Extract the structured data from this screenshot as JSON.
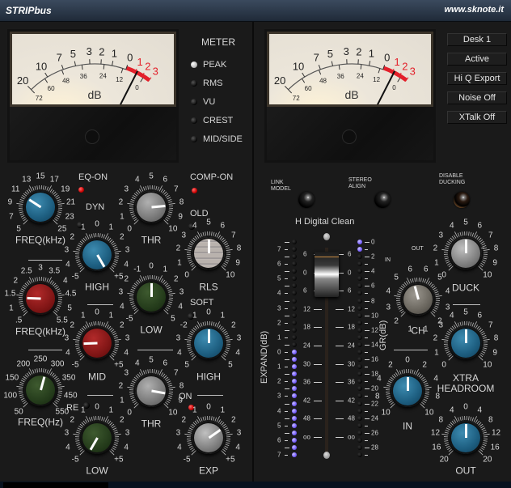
{
  "window": {
    "title": "STRIPbus",
    "url": "www.sknote.it"
  },
  "meter_left": {
    "upper_scale": [
      "20",
      "10",
      "7",
      "5",
      "3",
      "2",
      "1",
      "0",
      "1",
      "2",
      "3"
    ],
    "lower_scale": [
      "72",
      "60",
      "48",
      "36",
      "24",
      "12",
      "0"
    ],
    "unit": "dB",
    "needle_level_db": 1.2
  },
  "meter_right": {
    "upper_scale": [
      "20",
      "10",
      "7",
      "5",
      "3",
      "2",
      "1",
      "0",
      "1",
      "2",
      "3"
    ],
    "lower_scale": [
      "72",
      "60",
      "48",
      "36",
      "24",
      "12",
      "0"
    ],
    "unit": "dB",
    "needle_level_db": 1.2
  },
  "meter_modes": {
    "title": "METER",
    "options": [
      {
        "label": "PEAK",
        "selected": true
      },
      {
        "label": "RMS",
        "selected": false
      },
      {
        "label": "VU",
        "selected": false
      },
      {
        "label": "CREST",
        "selected": false
      },
      {
        "label": "MID/SIDE",
        "selected": false
      }
    ]
  },
  "buttons": [
    "Desk 1",
    "Active",
    "Hi Q Export",
    "Noise Off",
    "XTalk Off"
  ],
  "eq": {
    "on_label": "EQ-ON",
    "dyn_label": "DYN",
    "re_label": "RE",
    "high_freq": {
      "label": "FREQ(kHz)",
      "scale": [
        "5",
        "7",
        "9",
        "11",
        "13",
        "15",
        "17",
        "19",
        "21",
        "23",
        "25"
      ],
      "value": "11"
    },
    "high_gain": {
      "label": "HIGH",
      "scale": [
        "-5",
        "4",
        "3",
        "2",
        "1",
        "0",
        "1",
        "2",
        "3",
        "4",
        "+5"
      ],
      "value": "+3.5"
    },
    "mid_freq": {
      "label": "FREQ(kHz)",
      "scale": [
        ".5",
        "1",
        "1.5",
        "2",
        "2.5",
        "3",
        "3.5",
        "4",
        "4.5",
        "5",
        "5.5"
      ],
      "value": "1.5"
    },
    "mid_gain": {
      "label": "MID",
      "scale": [
        "-5",
        "4",
        "3",
        "2",
        "1",
        "0",
        "1",
        "2",
        "3",
        "4",
        "+5"
      ],
      "value": "-3"
    },
    "low_freq": {
      "label": "FREQ(Hz)",
      "scale": [
        "50",
        "100",
        "150",
        "200",
        "250",
        "300",
        "350",
        "450",
        "550"
      ],
      "value": "300"
    },
    "low_gain": {
      "label": "LOW",
      "scale": [
        "-5",
        "4",
        "3",
        "2",
        "1",
        "0",
        "1",
        "2",
        "3",
        "4",
        "+5"
      ],
      "value": "-3.5"
    }
  },
  "comp": {
    "on_label": "COMP-ON",
    "old_label": "OLD",
    "soft_label": "SOFT",
    "on2_label": "ON",
    "thr": {
      "label": "THR",
      "scale": [
        "0",
        "1",
        "2",
        "3",
        "4",
        "5",
        "6",
        "7",
        "8",
        "9",
        "10"
      ],
      "value": "8"
    },
    "rls": {
      "label": "RLS",
      "scale": [
        "0",
        "1",
        "2",
        "3",
        "4",
        "5",
        "6",
        "7",
        "8",
        "9",
        "10"
      ],
      "value": "5"
    },
    "low": {
      "label": "LOW",
      "scale": [
        "-5",
        "4",
        "3",
        "2",
        "-1",
        "0",
        "1",
        "2",
        "3",
        "4",
        "5"
      ],
      "value": "0"
    },
    "high": {
      "label": "HIGH",
      "scale": [
        "5",
        "4",
        "3",
        "-2",
        "1",
        "0",
        "1",
        "2",
        "3",
        "4",
        "5"
      ],
      "value": "0"
    },
    "exp_thr": {
      "label": "THR",
      "scale": [
        "0",
        "1",
        "2",
        "3",
        "4",
        "5",
        "6",
        "7",
        "8",
        "9",
        "10"
      ],
      "value": "8"
    },
    "exp": {
      "label": "EXP",
      "scale": [
        "-5",
        "4",
        "3",
        "2",
        "1",
        "0",
        "1",
        "2",
        "3",
        "4",
        "+5"
      ],
      "value": "+2"
    }
  },
  "console": {
    "link_model": "LINK\nMODEL",
    "stereo_align": "STEREO\nALIGN",
    "disable_ducking": "DISABLE\nDUCKING",
    "model_name": "H Digital Clean",
    "expand_label": "EXPAND(dB)",
    "gr_label": "GR(dB)",
    "expand_scale": [
      "7",
      "6",
      "5",
      "4",
      "3",
      "2",
      "1",
      "0",
      "1",
      "2",
      "3",
      "4",
      "5",
      "6",
      "7"
    ],
    "expand_leds_lit": 15,
    "fader_scale": [
      "6",
      "0",
      "6",
      "12",
      "18",
      "24",
      "30",
      "36",
      "42",
      "48",
      "oo"
    ],
    "fader_db": 0,
    "gr_scale": [
      "0",
      "2",
      "4",
      "6",
      "8",
      "10",
      "12",
      "14",
      "16",
      "18",
      "20",
      "22",
      "24",
      "26",
      "28"
    ],
    "gr_leds_lit": 2,
    "duck": {
      "label": "DUCK",
      "scale": [
        "0",
        "1",
        "2",
        "3",
        "4",
        "5",
        "6",
        "7",
        "8",
        "9",
        "10"
      ],
      "value": "5"
    },
    "ch": {
      "label": "CH",
      "in_label": "IN",
      "out_label": "OUT",
      "scale_left": [
        "1",
        "2",
        "3",
        "4",
        "5",
        "6"
      ],
      "scale_right": [
        "1",
        "2",
        "3",
        "4",
        "5",
        "6"
      ],
      "value": "IN 1"
    },
    "xtra_headroom": {
      "label": "XTRA\nHEADROOM",
      "scale": [
        "0",
        "1",
        "2",
        "3",
        "4",
        "5",
        "6",
        "7",
        "8",
        "9",
        "10"
      ],
      "value": "5"
    },
    "in": {
      "label": "IN",
      "scale": [
        "10",
        "8",
        "4",
        "2",
        "0",
        "2",
        "4",
        "8",
        "10"
      ],
      "value": "0"
    },
    "out": {
      "label": "OUT",
      "scale": [
        "20",
        "16",
        "12",
        "8",
        "4",
        "0",
        "4",
        "8",
        "12",
        "16",
        "20"
      ],
      "value": "0"
    }
  },
  "colors": {
    "accent_red": "#e8202a",
    "led_purple": "#7b63ff",
    "titlebar": "#2c3949"
  }
}
